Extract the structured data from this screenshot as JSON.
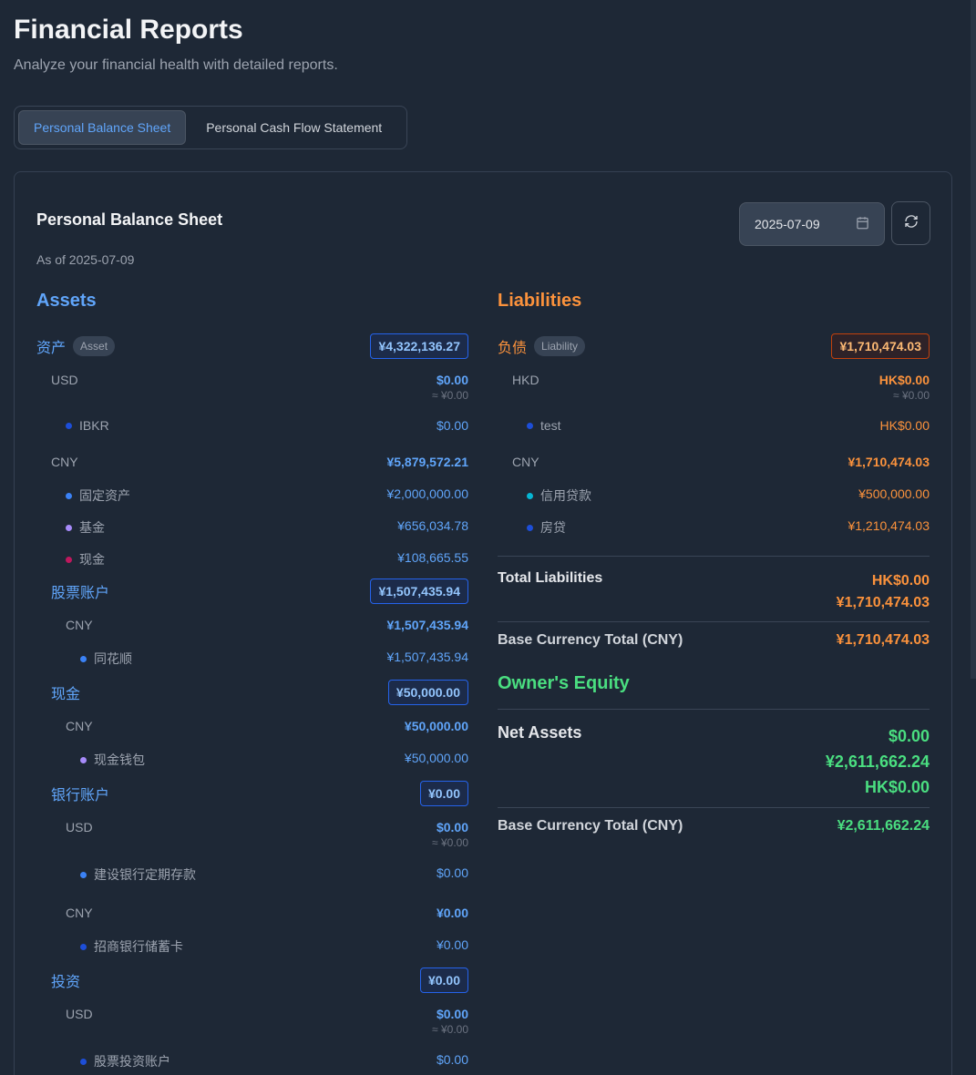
{
  "header": {
    "title": "Financial Reports",
    "subtitle": "Analyze your financial health with detailed reports."
  },
  "tabs": [
    {
      "label": "Personal Balance Sheet",
      "active": true
    },
    {
      "label": "Personal Cash Flow Statement",
      "active": false
    }
  ],
  "report": {
    "title": "Personal Balance Sheet",
    "as_of": "As of 2025-07-09",
    "date_value": "2025-07-09"
  },
  "assets": {
    "heading": "Assets",
    "groups": [
      {
        "name": "资产",
        "badge": "Asset",
        "total": "¥4,322,136.27",
        "currencies": [
          {
            "code": "USD",
            "value": "$0.00",
            "approx": "≈ ¥0.00",
            "items": [
              {
                "name": "IBKR",
                "value": "$0.00",
                "color": "#1d4ed8"
              }
            ]
          },
          {
            "code": "CNY",
            "value": "¥5,879,572.21",
            "approx": "",
            "items": [
              {
                "name": "固定资产",
                "value": "¥2,000,000.00",
                "color": "#3b82f6"
              },
              {
                "name": "基金",
                "value": "¥656,034.78",
                "color": "#a78bfa"
              },
              {
                "name": "现金",
                "value": "¥108,665.55",
                "color": "#be185d"
              }
            ]
          }
        ]
      },
      {
        "name": "股票账户",
        "badge": "",
        "total": "¥1,507,435.94",
        "currencies": [
          {
            "code": "CNY",
            "value": "¥1,507,435.94",
            "approx": "",
            "items": [
              {
                "name": "同花顺",
                "value": "¥1,507,435.94",
                "color": "#3b82f6"
              }
            ]
          }
        ]
      },
      {
        "name": "现金",
        "badge": "",
        "total": "¥50,000.00",
        "currencies": [
          {
            "code": "CNY",
            "value": "¥50,000.00",
            "approx": "",
            "items": [
              {
                "name": "现金钱包",
                "value": "¥50,000.00",
                "color": "#a78bfa"
              }
            ]
          }
        ]
      },
      {
        "name": "银行账户",
        "badge": "",
        "total": "¥0.00",
        "currencies": [
          {
            "code": "USD",
            "value": "$0.00",
            "approx": "≈ ¥0.00",
            "items": [
              {
                "name": "建设银行定期存款",
                "value": "$0.00",
                "color": "#3b82f6"
              }
            ]
          },
          {
            "code": "CNY",
            "value": "¥0.00",
            "approx": "",
            "items": [
              {
                "name": "招商银行储蓄卡",
                "value": "¥0.00",
                "color": "#1d4ed8"
              }
            ]
          }
        ]
      },
      {
        "name": "投资",
        "badge": "",
        "total": "¥0.00",
        "currencies": [
          {
            "code": "USD",
            "value": "$0.00",
            "approx": "≈ ¥0.00",
            "items": [
              {
                "name": "股票投资账户",
                "value": "$0.00",
                "color": "#1d4ed8"
              }
            ]
          }
        ]
      }
    ]
  },
  "liabilities": {
    "heading": "Liabilities",
    "group": {
      "name": "负债",
      "badge": "Liability",
      "total": "¥1,710,474.03",
      "currencies": [
        {
          "code": "HKD",
          "value": "HK$0.00",
          "approx": "≈ ¥0.00",
          "items": [
            {
              "name": "test",
              "value": "HK$0.00",
              "color": "#1d4ed8"
            }
          ]
        },
        {
          "code": "CNY",
          "value": "¥1,710,474.03",
          "approx": "",
          "items": [
            {
              "name": "信用贷款",
              "value": "¥500,000.00",
              "color": "#06b6d4"
            },
            {
              "name": "房贷",
              "value": "¥1,210,474.03",
              "color": "#1d4ed8"
            }
          ]
        }
      ]
    },
    "total_label": "Total Liabilities",
    "total_values": [
      "HK$0.00",
      "¥1,710,474.03"
    ],
    "base_label": "Base Currency Total (CNY)",
    "base_value": "¥1,710,474.03"
  },
  "equity": {
    "heading": "Owner's Equity",
    "net_label": "Net Assets",
    "net_values": [
      "$0.00",
      "¥2,611,662.24",
      "HK$0.00"
    ],
    "base_label": "Base Currency Total (CNY)",
    "base_value": "¥2,611,662.24"
  },
  "icons": {
    "calendar": "calendar-icon",
    "refresh": "refresh-icon"
  },
  "colors": {
    "assets": "#60a5fa",
    "liabilities": "#fb923c",
    "equity": "#4ade80",
    "background": "#1e2836"
  }
}
